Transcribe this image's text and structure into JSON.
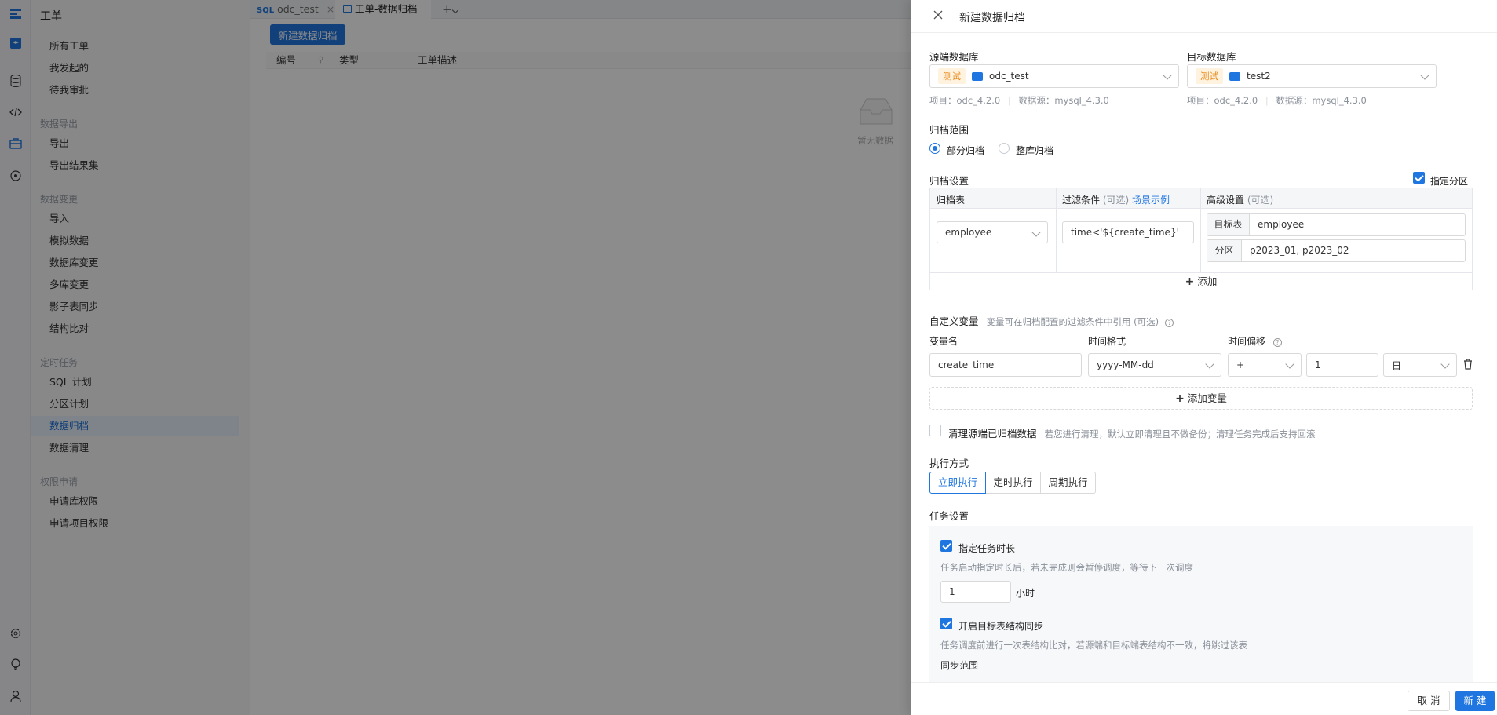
{
  "nav": {
    "title": "工单",
    "items": [
      "所有工单",
      "我发起的",
      "待我审批"
    ],
    "groups": [
      {
        "label": "数据导出",
        "items": [
          "导出",
          "导出结果集"
        ]
      },
      {
        "label": "数据变更",
        "items": [
          "导入",
          "模拟数据",
          "数据库变更",
          "多库变更",
          "影子表同步",
          "结构比对"
        ]
      },
      {
        "label": "定时任务",
        "items": [
          "SQL 计划",
          "分区计划",
          "数据归档",
          "数据清理"
        ]
      },
      {
        "label": "权限申请",
        "items": [
          "申请库权限",
          "申请项目权限"
        ]
      }
    ],
    "active": "数据归档"
  },
  "tabs": [
    {
      "icon": "SQL",
      "label": "odc_test",
      "close": "×"
    },
    {
      "label": "工单-数据归档"
    }
  ],
  "toolbar": {
    "new_button": "新建数据归档"
  },
  "table": {
    "columns": [
      "编号",
      "类型",
      "工单描述"
    ],
    "empty_text": "暂无数据"
  },
  "drawer": {
    "title": "新建数据归档",
    "source": {
      "label": "源端数据库",
      "env_tag": "测试",
      "db": "odc_test",
      "project": "项目：odc_4.2.0",
      "datasource": "数据源：mysql_4.3.0"
    },
    "target": {
      "label": "目标数据库",
      "env_tag": "测试",
      "db": "test2",
      "project": "项目：odc_4.2.0",
      "datasource": "数据源：mysql_4.3.0"
    },
    "scope": {
      "label": "归档范围",
      "options": [
        "部分归档",
        "整库归档"
      ],
      "selected": "部分归档"
    },
    "settings": {
      "label": "归档设置",
      "specify_partition": "指定分区",
      "col_table": "归档表",
      "col_filter": "过滤条件",
      "optional": "(可选)",
      "example_link": "场景示例",
      "col_advanced": "高级设置",
      "row": {
        "table": "employee",
        "filter": "time<'${create_time}'",
        "target_label": "目标表",
        "target_value": "employee",
        "partition_label": "分区",
        "partition_value": "p2023_01, p2023_02"
      },
      "add": "添加"
    },
    "variables": {
      "label": "自定义变量",
      "hint": "变量可在归档配置的过滤条件中引用 (可选)",
      "col_name": "变量名",
      "col_format": "时间格式",
      "col_offset": "时间偏移",
      "row": {
        "name": "create_time",
        "format": "yyyy-MM-dd",
        "op": "+",
        "amount": "1",
        "unit": "日"
      },
      "add": "添加变量"
    },
    "cleanup": {
      "label": "清理源端已归档数据",
      "hint": "若您进行清理，默认立即清理且不做备份；清理任务完成后支持回滚"
    },
    "execution": {
      "label": "执行方式",
      "options": [
        "立即执行",
        "定时执行",
        "周期执行"
      ],
      "selected": "立即执行"
    },
    "task": {
      "label": "任务设置",
      "duration_label": "指定任务时长",
      "duration_hint": "任务启动指定时长后，若未完成则会暂停调度，等待下一次调度",
      "duration_value": "1",
      "duration_unit": "小时",
      "sync_label": "开启目标表结构同步",
      "sync_hint": "任务调度前进行一次表结构比对，若源端和目标端表结构不一致，将跳过该表",
      "sync_scope": "同步范围"
    },
    "footer": {
      "cancel": "取 消",
      "submit": "新 建"
    }
  }
}
